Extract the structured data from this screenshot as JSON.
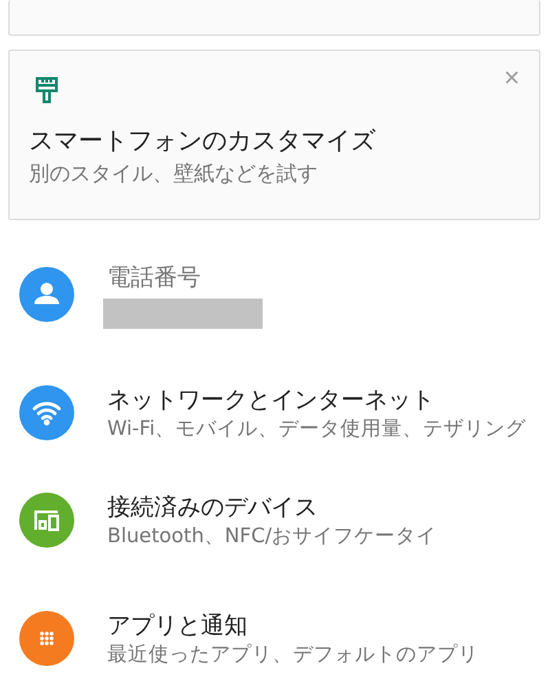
{
  "suggestion_card": {
    "title": "スマートフォンのカスタマイズ",
    "subtitle": "別のスタイル、壁紙などを試す",
    "close": "×"
  },
  "settings": [
    {
      "kind": "account",
      "color": "#2f95ee",
      "muted": true,
      "title": "電話番号"
    },
    {
      "kind": "network",
      "color": "#2f95ee",
      "muted": false,
      "title": "ネットワークとインターネット",
      "subtitle": "Wi-Fi、モバイル、データ使用量、テザリング"
    },
    {
      "kind": "devices",
      "color": "#62ae2d",
      "muted": false,
      "title": "接続済みのデバイス",
      "subtitle": "Bluetooth、NFC/おサイフケータイ"
    },
    {
      "kind": "apps",
      "color": "#f47b20",
      "muted": false,
      "title": "アプリと通知",
      "subtitle": "最近使ったアプリ、デフォルトのアプリ"
    }
  ]
}
